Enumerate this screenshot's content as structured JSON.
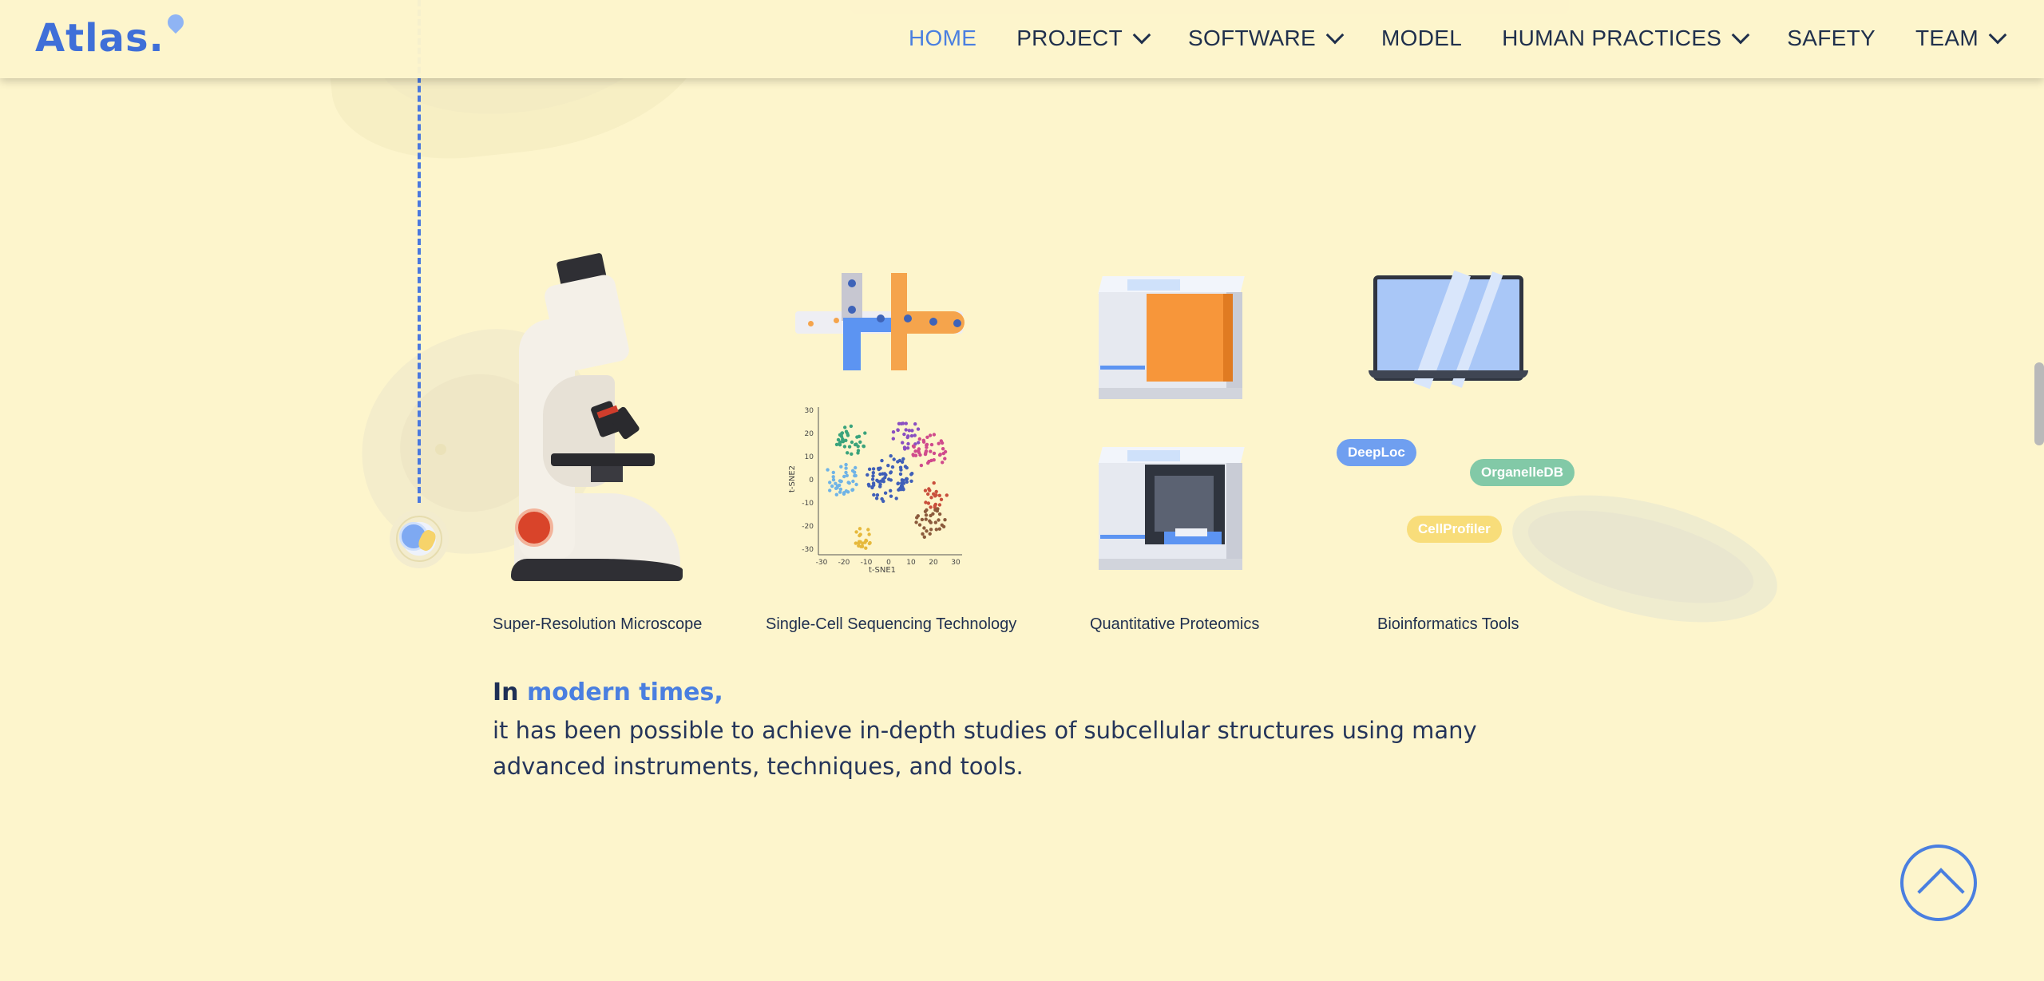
{
  "brand": {
    "name": "Atlas.",
    "accent": "#4a7fe0"
  },
  "nav": {
    "items": [
      {
        "label": "HOME",
        "active": true,
        "has_dropdown": false
      },
      {
        "label": "PROJECT",
        "active": false,
        "has_dropdown": true
      },
      {
        "label": "SOFTWARE",
        "active": false,
        "has_dropdown": true
      },
      {
        "label": "MODEL",
        "active": false,
        "has_dropdown": false
      },
      {
        "label": "HUMAN PRACTICES",
        "active": false,
        "has_dropdown": true
      },
      {
        "label": "SAFETY",
        "active": false,
        "has_dropdown": false
      },
      {
        "label": "TEAM",
        "active": false,
        "has_dropdown": true
      }
    ]
  },
  "tools": {
    "microscope": "Super-Resolution Microscope",
    "sequencing": "Single-Cell Sequencing Technology",
    "proteomics": "Quantitative Proteomics",
    "bioinformatics": "Bioinformatics Tools",
    "tags": {
      "deeploc": {
        "label": "DeepLoc",
        "color": "#6f9ff0"
      },
      "organelledb": {
        "label": "OrganelleDB",
        "color": "#82c9a7"
      },
      "cellprofiler": {
        "label": "CellProfiler",
        "color": "#f8dd7a"
      }
    },
    "tsne": {
      "xlabel": "t-SNE1",
      "ylabel": "t-SNE2",
      "xticks": [
        "-30",
        "-20",
        "-10",
        "0",
        "10",
        "20",
        "30"
      ],
      "yticks": [
        "30",
        "20",
        "10",
        "0",
        "-10",
        "-20",
        "-30"
      ]
    }
  },
  "intro": {
    "lead": "In",
    "highlight": "modern times,",
    "body": "it has been possible to achieve in-depth studies of subcellular structures using many advanced instruments, techniques, and tools."
  },
  "icons": {
    "back_to_top": "chevron-up-icon",
    "dropdown": "chevron-down-icon",
    "logo_pin": "location-pin-icon"
  }
}
